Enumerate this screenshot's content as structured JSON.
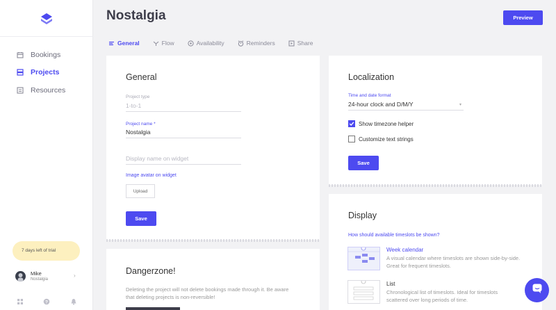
{
  "sidebar": {
    "nav": [
      {
        "label": "Bookings",
        "icon": "calendar-icon"
      },
      {
        "label": "Projects",
        "icon": "projects-icon"
      },
      {
        "label": "Resources",
        "icon": "resources-icon"
      }
    ],
    "trial_text": "7 days left of trial",
    "user": {
      "name": "Mike",
      "project": "Nostalgia"
    }
  },
  "header": {
    "title": "Nostalgia",
    "preview_label": "Preview",
    "tabs": [
      {
        "label": "General",
        "icon": "general-icon"
      },
      {
        "label": "Flow",
        "icon": "flow-icon"
      },
      {
        "label": "Availability",
        "icon": "availability-icon"
      },
      {
        "label": "Reminders",
        "icon": "reminders-icon"
      },
      {
        "label": "Share",
        "icon": "share-icon"
      }
    ]
  },
  "general": {
    "title": "General",
    "project_type_label": "Project type",
    "project_type_value": "1-to-1",
    "project_name_label": "Project name *",
    "project_name_value": "Nostalgia",
    "display_name_placeholder": "Display name on widget",
    "image_avatar_link": "Image avatar on widget",
    "upload_label": "Upload",
    "save_label": "Save"
  },
  "localization": {
    "title": "Localization",
    "format_label": "Time and date format",
    "format_value": "24-hour clock and D/M/Y",
    "show_timezone_label": "Show timezone helper",
    "show_timezone_checked": true,
    "customize_label": "Customize text strings",
    "customize_checked": false,
    "save_label": "Save"
  },
  "display": {
    "title": "Display",
    "question": "How should available timeslots be shown?",
    "options": [
      {
        "title": "Week calendar",
        "desc_line1": "A visual calendar where timeslots are shown side-by-side.",
        "desc_line2": "Great for frequent timeslots."
      },
      {
        "title": "List",
        "desc_line1": "Chronological list of timeslots. Ideal for timeslots",
        "desc_line2": "scattered over long periods of time."
      }
    ]
  },
  "dangerzone": {
    "title": "Dangerzone!",
    "desc_line1": "Deleting the project will not delete bookings made through it. Be aware",
    "desc_line2": "that deleting projects is non-reversible!"
  },
  "colors": {
    "accent": "#4d4af0",
    "trial_bg": "#fdf0bf",
    "page_bg": "#f2f2f4"
  }
}
